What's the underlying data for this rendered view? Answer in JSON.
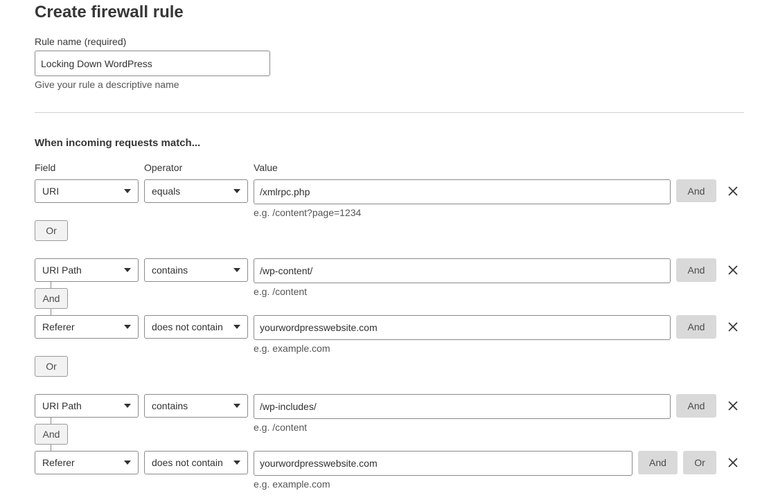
{
  "page_title": "Create firewall rule",
  "rule_name": {
    "label": "Rule name (required)",
    "value": "Locking Down WordPress",
    "hint": "Give your rule a descriptive name"
  },
  "section_heading": "When incoming requests match...",
  "columns": {
    "field": "Field",
    "operator": "Operator",
    "value": "Value"
  },
  "expressions": [
    {
      "field": "URI",
      "operator": "equals",
      "value": "/xmlrpc.php",
      "hint": "e.g. /content?page=1234",
      "and_label": "And"
    },
    {
      "field": "URI Path",
      "operator": "contains",
      "value": "/wp-content/",
      "hint": "e.g. /content",
      "and_label": "And"
    },
    {
      "field": "Referer",
      "operator": "does not contain",
      "value": "yourwordpresswebsite.com",
      "hint": "e.g. example.com",
      "and_label": "And"
    },
    {
      "field": "URI Path",
      "operator": "contains",
      "value": "/wp-includes/",
      "hint": "e.g. /content",
      "and_label": "And"
    },
    {
      "field": "Referer",
      "operator": "does not contain",
      "value": "yourwordpresswebsite.com",
      "hint": "e.g. example.com",
      "and_label": "And",
      "or_label": "Or"
    }
  ],
  "connectors": {
    "or": "Or",
    "and": "And"
  },
  "icons": {
    "remove": "close-icon",
    "dropdown": "chevron-down-icon"
  }
}
